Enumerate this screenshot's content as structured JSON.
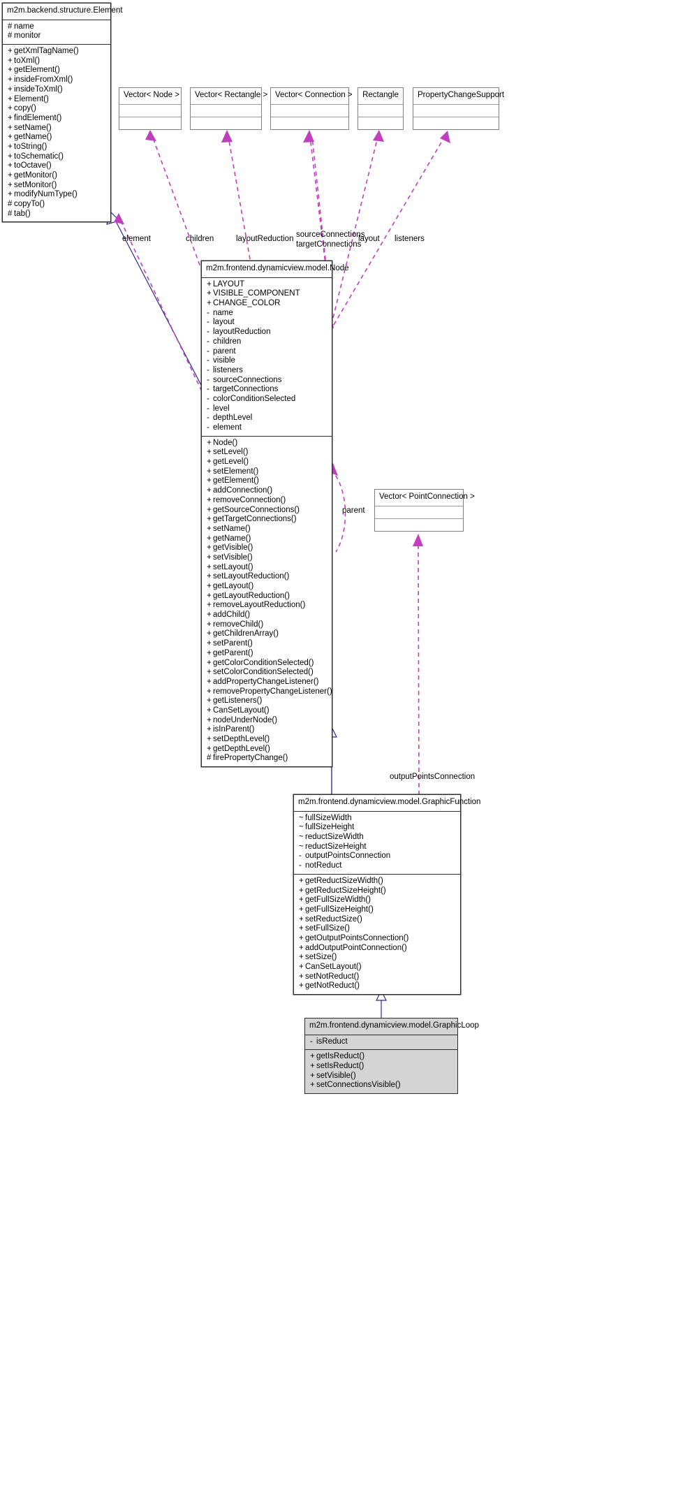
{
  "diagram": {
    "kind": "uml-class-diagram",
    "colors": {
      "box_border": "#2d2d2d",
      "light_border": "#9a9a9a",
      "inheritance_edge": "#2b2b8f",
      "association_edge": "#bf3fbf",
      "highlight_fill": "#d4d4d4",
      "background": "#ffffff"
    }
  },
  "classes": {
    "element": {
      "name": "m2m.backend.structure.Element",
      "attributes": [
        {
          "vis": "#",
          "label": "name"
        },
        {
          "vis": "#",
          "label": "monitor"
        }
      ],
      "methods": [
        {
          "vis": "+",
          "label": "getXmlTagName()"
        },
        {
          "vis": "+",
          "label": "toXml()"
        },
        {
          "vis": "+",
          "label": "getElement()"
        },
        {
          "vis": "+",
          "label": "insideFromXml()"
        },
        {
          "vis": "+",
          "label": "insideToXml()"
        },
        {
          "vis": "+",
          "label": "Element()"
        },
        {
          "vis": "+",
          "label": "copy()"
        },
        {
          "vis": "+",
          "label": "findElement()"
        },
        {
          "vis": "+",
          "label": "setName()"
        },
        {
          "vis": "+",
          "label": "getName()"
        },
        {
          "vis": "+",
          "label": "toString()"
        },
        {
          "vis": "+",
          "label": "toSchematic()"
        },
        {
          "vis": "+",
          "label": "toOctave()"
        },
        {
          "vis": "+",
          "label": "getMonitor()"
        },
        {
          "vis": "+",
          "label": "setMonitor()"
        },
        {
          "vis": "+",
          "label": "modifyNumType()"
        },
        {
          "vis": "#",
          "label": "copyTo()"
        },
        {
          "vis": "#",
          "label": "tab()"
        }
      ]
    },
    "vector_node": {
      "name": "Vector< Node >",
      "attributes": [],
      "methods": []
    },
    "vector_rectangle": {
      "name": "Vector< Rectangle >",
      "attributes": [],
      "methods": []
    },
    "vector_connection": {
      "name": "Vector< Connection >",
      "attributes": [],
      "methods": []
    },
    "rectangle": {
      "name": "Rectangle",
      "attributes": [],
      "methods": []
    },
    "property_change_support": {
      "name": "PropertyChangeSupport",
      "attributes": [],
      "methods": []
    },
    "vector_pointconnection": {
      "name": "Vector< PointConnection >",
      "attributes": [],
      "methods": []
    },
    "node": {
      "name": "m2m.frontend.dynamicview.model.Node",
      "attributes": [
        {
          "vis": "+",
          "label": "LAYOUT"
        },
        {
          "vis": "+",
          "label": "VISIBLE_COMPONENT"
        },
        {
          "vis": "+",
          "label": "CHANGE_COLOR"
        },
        {
          "vis": "-",
          "label": "name"
        },
        {
          "vis": "-",
          "label": "layout"
        },
        {
          "vis": "-",
          "label": "layoutReduction"
        },
        {
          "vis": "-",
          "label": "children"
        },
        {
          "vis": "-",
          "label": "parent"
        },
        {
          "vis": "-",
          "label": "visible"
        },
        {
          "vis": "-",
          "label": "listeners"
        },
        {
          "vis": "-",
          "label": "sourceConnections"
        },
        {
          "vis": "-",
          "label": "targetConnections"
        },
        {
          "vis": "-",
          "label": "colorConditionSelected"
        },
        {
          "vis": "-",
          "label": "level"
        },
        {
          "vis": "-",
          "label": "depthLevel"
        },
        {
          "vis": "-",
          "label": "element"
        }
      ],
      "methods": [
        {
          "vis": "+",
          "label": "Node()"
        },
        {
          "vis": "+",
          "label": "setLevel()"
        },
        {
          "vis": "+",
          "label": "getLevel()"
        },
        {
          "vis": "+",
          "label": "setElement()"
        },
        {
          "vis": "+",
          "label": "getElement()"
        },
        {
          "vis": "+",
          "label": "addConnection()"
        },
        {
          "vis": "+",
          "label": "removeConnection()"
        },
        {
          "vis": "+",
          "label": "getSourceConnections()"
        },
        {
          "vis": "+",
          "label": "getTargetConnections()"
        },
        {
          "vis": "+",
          "label": "setName()"
        },
        {
          "vis": "+",
          "label": "getName()"
        },
        {
          "vis": "+",
          "label": "getVisible()"
        },
        {
          "vis": "+",
          "label": "setVisible()"
        },
        {
          "vis": "+",
          "label": "setLayout()"
        },
        {
          "vis": "+",
          "label": "setLayoutReduction()"
        },
        {
          "vis": "+",
          "label": "getLayout()"
        },
        {
          "vis": "+",
          "label": "getLayoutReduction()"
        },
        {
          "vis": "+",
          "label": "removeLayoutReduction()"
        },
        {
          "vis": "+",
          "label": "addChild()"
        },
        {
          "vis": "+",
          "label": "removeChild()"
        },
        {
          "vis": "+",
          "label": "getChildrenArray()"
        },
        {
          "vis": "+",
          "label": "setParent()"
        },
        {
          "vis": "+",
          "label": "getParent()"
        },
        {
          "vis": "+",
          "label": "getColorConditionSelected()"
        },
        {
          "vis": "+",
          "label": "setColorConditionSelected()"
        },
        {
          "vis": "+",
          "label": "addPropertyChangeListener()"
        },
        {
          "vis": "+",
          "label": "removePropertyChangeListener()"
        },
        {
          "vis": "+",
          "label": "getListeners()"
        },
        {
          "vis": "+",
          "label": "CanSetLayout()"
        },
        {
          "vis": "+",
          "label": "nodeUnderNode()"
        },
        {
          "vis": "+",
          "label": "isInParent()"
        },
        {
          "vis": "+",
          "label": "setDepthLevel()"
        },
        {
          "vis": "+",
          "label": "getDepthLevel()"
        },
        {
          "vis": "#",
          "label": "firePropertyChange()"
        }
      ]
    },
    "graphic_function": {
      "name": "m2m.frontend.dynamicview.model.GraphicFunction",
      "attributes": [
        {
          "vis": "~",
          "label": "fullSizeWidth"
        },
        {
          "vis": "~",
          "label": "fullSizeHeight"
        },
        {
          "vis": "~",
          "label": "reductSizeWidth"
        },
        {
          "vis": "~",
          "label": "reductSizeHeight"
        },
        {
          "vis": "-",
          "label": "outputPointsConnection"
        },
        {
          "vis": "-",
          "label": "notReduct"
        }
      ],
      "methods": [
        {
          "vis": "+",
          "label": "getReductSizeWidth()"
        },
        {
          "vis": "+",
          "label": "getReductSizeHeight()"
        },
        {
          "vis": "+",
          "label": "getFullSizeWidth()"
        },
        {
          "vis": "+",
          "label": "getFullSizeHeight()"
        },
        {
          "vis": "+",
          "label": "setReductSize()"
        },
        {
          "vis": "+",
          "label": "setFullSize()"
        },
        {
          "vis": "+",
          "label": "getOutputPointsConnection()"
        },
        {
          "vis": "+",
          "label": "addOutputPointConnection()"
        },
        {
          "vis": "+",
          "label": "setSize()"
        },
        {
          "vis": "+",
          "label": "CanSetLayout()"
        },
        {
          "vis": "+",
          "label": "setNotReduct()"
        },
        {
          "vis": "+",
          "label": "getNotReduct()"
        }
      ]
    },
    "graphic_loop": {
      "name": "m2m.frontend.dynamicview.model.GraphicLoop",
      "attributes": [
        {
          "vis": "-",
          "label": "isReduct"
        }
      ],
      "methods": [
        {
          "vis": "+",
          "label": "getIsReduct()"
        },
        {
          "vis": "+",
          "label": "setIsReduct()"
        },
        {
          "vis": "+",
          "label": "setVisible()"
        },
        {
          "vis": "+",
          "label": "setConnectionsVisible()"
        }
      ]
    }
  },
  "edge_labels": {
    "element": "element",
    "children": "children",
    "layout_reduction": "layoutReduction",
    "source_connections": "sourceConnections",
    "target_connections": "targetConnections",
    "layout": "layout",
    "listeners": "listeners",
    "parent": "parent",
    "output_points_connection": "outputPointsConnection"
  }
}
